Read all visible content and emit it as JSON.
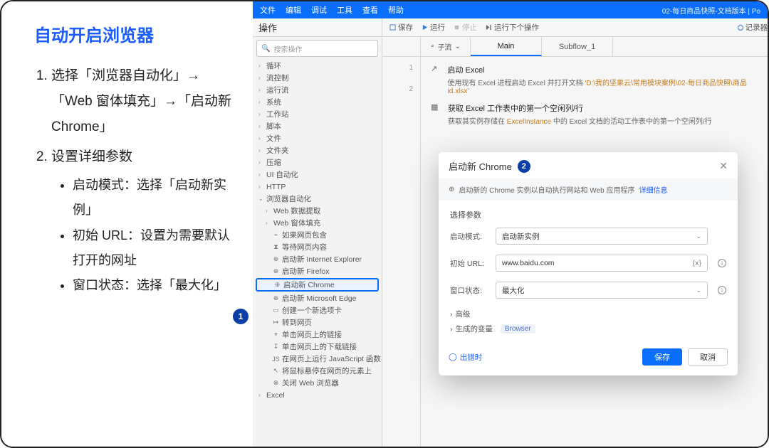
{
  "doc": {
    "title": "自动开启浏览器",
    "step1": "选择「浏览器自动化」→「Web 窗体填充」→「启动新 Chrome」",
    "step2": "设置详细参数",
    "bullets": {
      "b1": "启动模式：选择「启动新实例」",
      "b2": "初始 URL：设置为需要默认打开的网址",
      "b3": "窗口状态：选择「最大化」"
    }
  },
  "menu": {
    "file": "文件",
    "edit": "编辑",
    "debug": "调试",
    "tools": "工具",
    "view": "查看",
    "help": "帮助",
    "doc_title": "02-每日商品快照-文档版本 | Po"
  },
  "toolbar": {
    "ops": "操作",
    "save": "保存",
    "run": "运行",
    "stop": "停止",
    "run_next": "运行下个操作",
    "recorder": "记录器"
  },
  "search_placeholder": "搜索操作",
  "tree": {
    "loop": "循环",
    "flow": "流控制",
    "runflow": "运行流",
    "system": "系统",
    "workstation": "工作站",
    "script": "脚本",
    "file": "文件",
    "folder": "文件夹",
    "compress": "压缩",
    "ui": "UI 自动化",
    "http": "HTTP",
    "browser_auto": "浏览器自动化",
    "web_extract": "Web 数据提取",
    "web_form": "Web 窗体填充",
    "if_contains": "如果网页包含",
    "wait_content": "等待网页内容",
    "launch_ie": "启动新 Internet Explorer",
    "launch_ff": "启动新 Firefox",
    "launch_chrome": "启动新 Chrome",
    "launch_edge": "启动新 Microsoft Edge",
    "new_tab": "创建一个新选项卡",
    "goto": "转到网页",
    "click_link": "单击网页上的链接",
    "click_dl": "单击网页上的下载链接",
    "run_js": "在网页上运行 JavaScript 函数",
    "hover": "将鼠标悬停在网页的元素上",
    "close": "关闭 Web 浏览器",
    "excel": "Excel"
  },
  "line_numbers": {
    "l1": "1",
    "l2": "2"
  },
  "subflow_label": "子流",
  "tabs": {
    "main": "Main",
    "sub1": "Subflow_1"
  },
  "cards": {
    "c1_title": "启动 Excel",
    "c1_desc_a": "使用现有 Excel 进程启动 Excel 并打开文档 ",
    "c1_desc_b": "'D:\\我的坚果云\\常用模块案例\\02-每日商品快照\\商品id.xlsx'",
    "c2_title": "获取 Excel 工作表中的第一个空闲列/行",
    "c2_desc_a": "获取其实例存储在 ",
    "c2_desc_b": "ExcelInstance",
    "c2_desc_c": " 中的 Excel 文档的活动工作表中的第一个空闲列/行"
  },
  "dialog": {
    "title": "启动新 Chrome",
    "info_a": "启动新的 Chrome 实例以自动执行网站和 Web 应用程序 ",
    "info_link": "详细信息",
    "section": "选择参数",
    "launch_mode_lbl": "启动模式:",
    "launch_mode_val": "启动新实例",
    "url_lbl": "初始 URL:",
    "url_val": "www.baidu.com",
    "win_state_lbl": "窗口状态:",
    "win_state_val": "最大化",
    "advanced": "高级",
    "vars_label": "生成的变量",
    "vars_tag": "Browser",
    "on_error": "出错时",
    "save": "保存",
    "cancel": "取消"
  }
}
